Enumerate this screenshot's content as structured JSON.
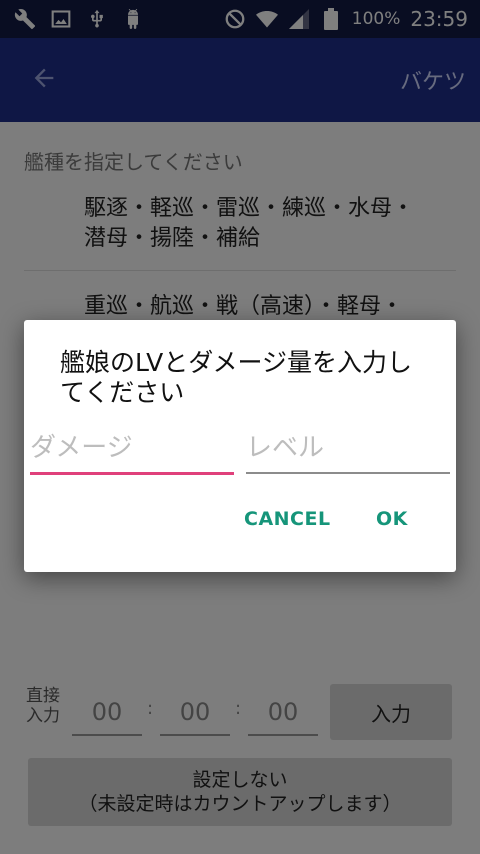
{
  "status_bar": {
    "icons_left": [
      "wrench-icon",
      "image-icon",
      "usb-icon",
      "android-icon"
    ],
    "battery": "100%",
    "time": "23:59"
  },
  "app_bar": {
    "action": "バケツ"
  },
  "main": {
    "section_label": "艦種を指定してください",
    "ship_types_1_line1": "駆逐・軽巡・雷巡・練巡・水母・",
    "ship_types_1_line2": "潜母・揚陸・補給",
    "ship_types_2_line1": "重巡・航巡・戦（高速）・軽母・",
    "direct_label_line1": "直接",
    "direct_label_line2": "入力",
    "hour": "00",
    "minute": "00",
    "second": "00",
    "colon": ":",
    "input_button": "入力",
    "no_setting_line1": "設定しない",
    "no_setting_line2": "（未設定時はカウントアップします）"
  },
  "dialog": {
    "title": "艦娘のLVとダメージ量を入力してください",
    "damage_placeholder": "ダメージ",
    "level_placeholder": "レベル",
    "cancel": "CANCEL",
    "ok": "OK"
  },
  "colors": {
    "status_bar": "#121a45",
    "app_bar": "#1f2e8a",
    "accent": "#16957a",
    "focus_underline": "#e0407b"
  }
}
